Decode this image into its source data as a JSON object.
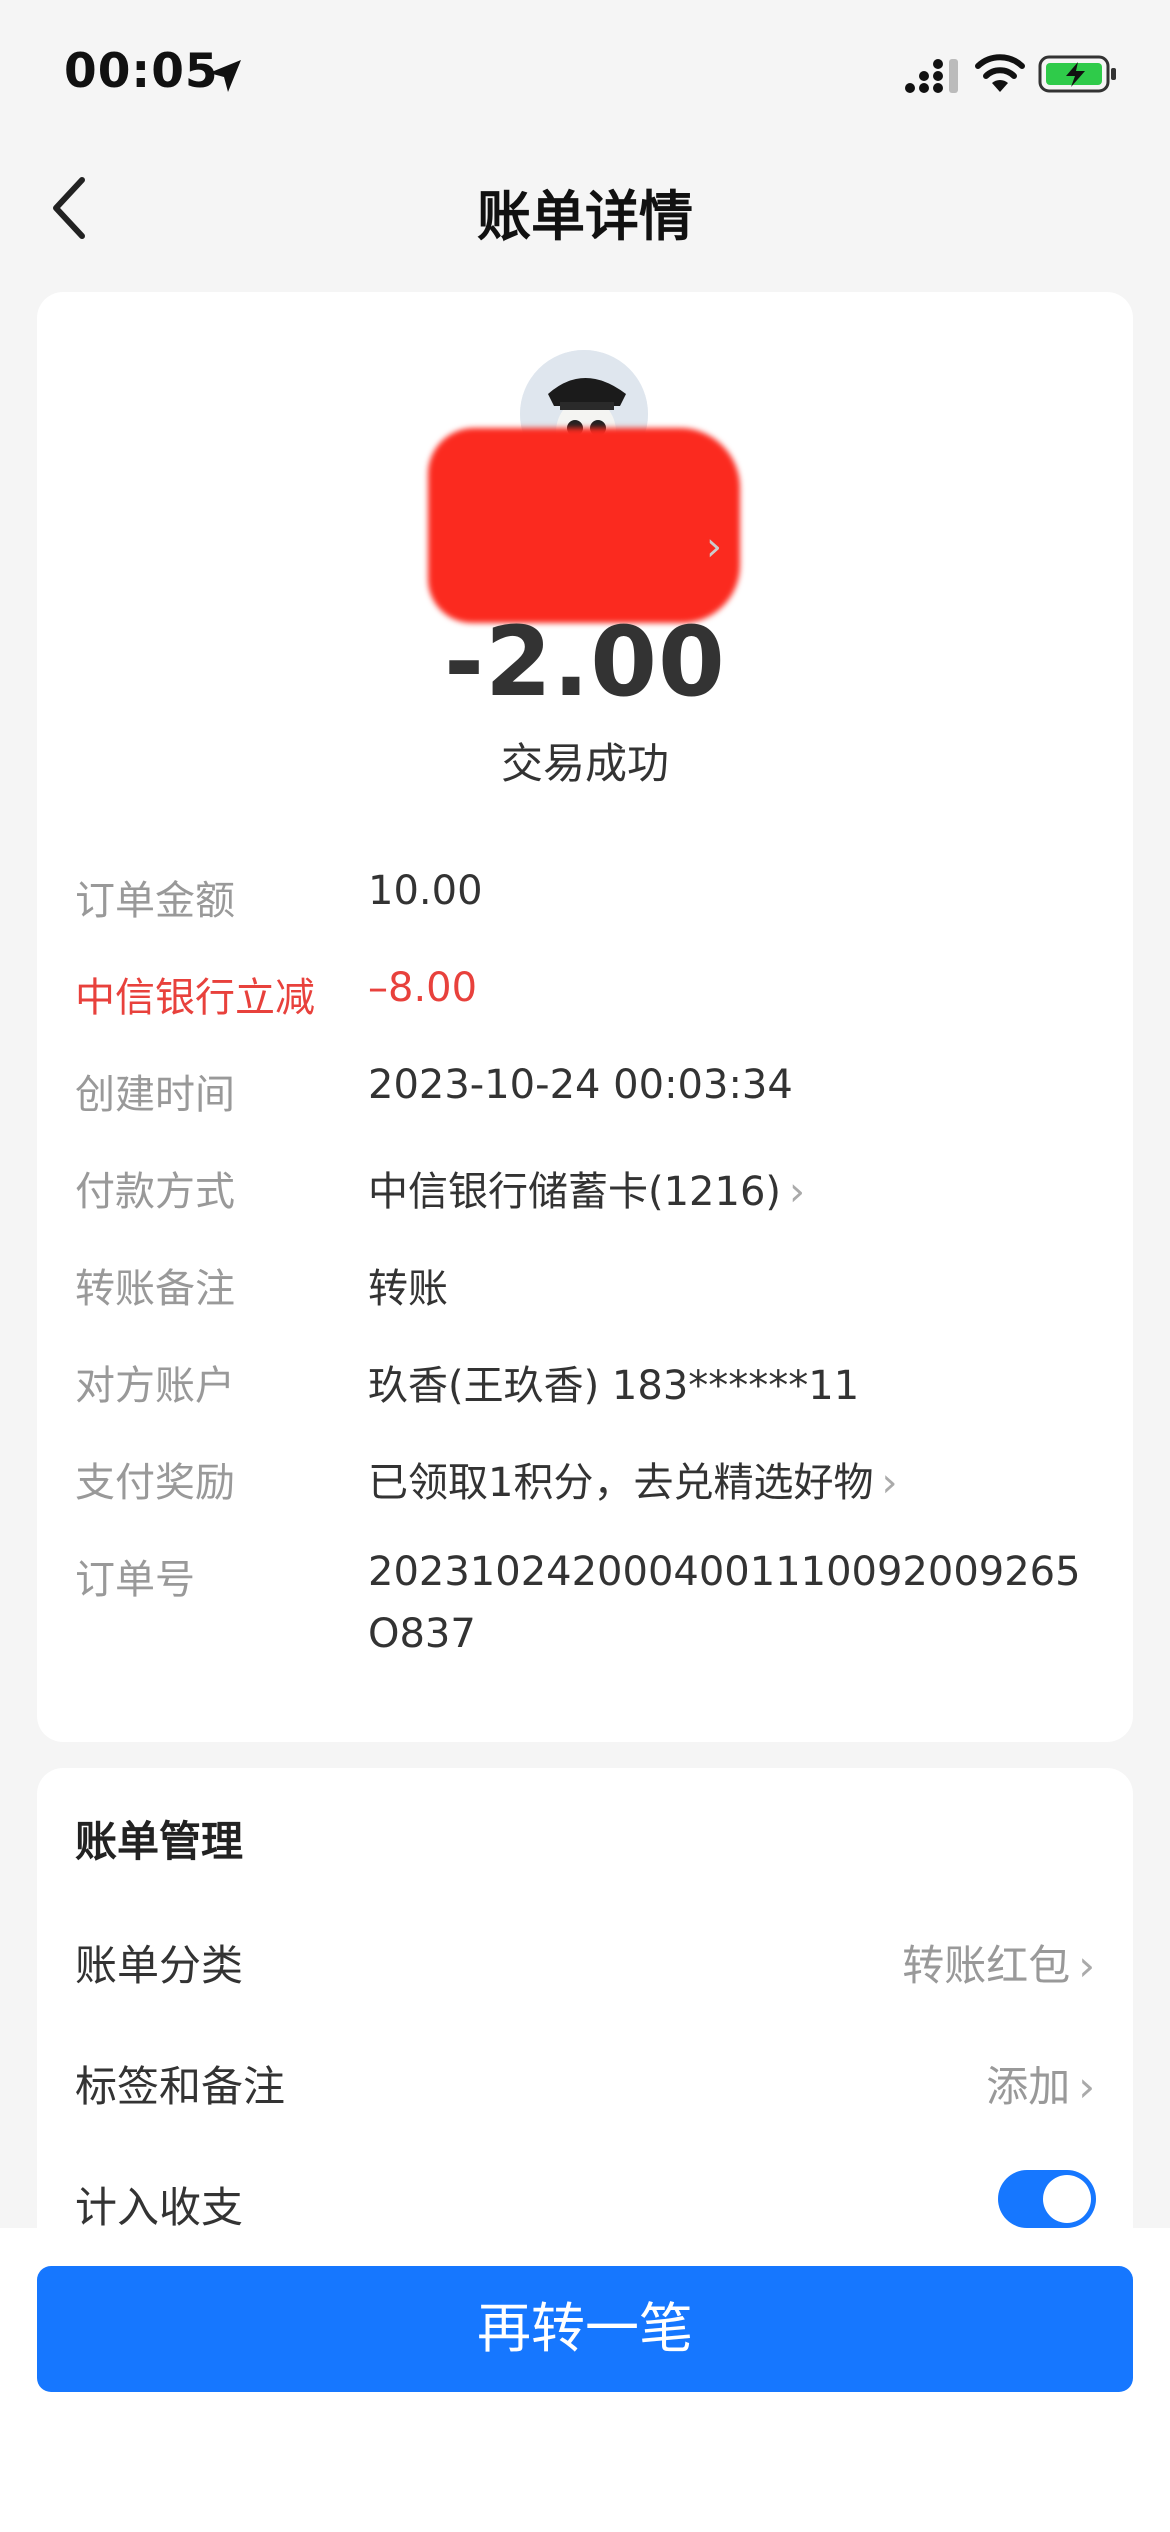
{
  "status_bar": {
    "time": "00:05"
  },
  "nav": {
    "title": "账单详情"
  },
  "transaction": {
    "amount": "-2.00",
    "status": "交易成功",
    "details": [
      {
        "label": "订单金额",
        "value": "10.00"
      },
      {
        "label": "中信银行立减",
        "value": "–8.00",
        "highlight": true
      },
      {
        "label": "创建时间",
        "value": "2023-10-24 00:03:34"
      },
      {
        "label": "付款方式",
        "value": "中信银行储蓄卡(1216)",
        "chevron": true
      },
      {
        "label": "转账备注",
        "value": "转账"
      },
      {
        "label": "对方账户",
        "value": "玖香(王玖香) 183******11"
      },
      {
        "label": "支付奖励",
        "value": "已领取1积分，去兑精选好物",
        "chevron": true
      },
      {
        "label": "订单号",
        "value": "2023102420004001110092009265O837"
      }
    ]
  },
  "management": {
    "title": "账单管理",
    "items": [
      {
        "label": "账单分类",
        "value": "转账红包"
      },
      {
        "label": "标签和备注",
        "value": "添加"
      },
      {
        "label": "计入收支",
        "toggle_on": true
      }
    ]
  },
  "actions": {
    "transfer_again": "再转一笔"
  },
  "colors": {
    "accent": "#1677ff",
    "discount_red": "#e8413c",
    "redaction": "#fb2a1f"
  },
  "icons": {
    "back": "chevron-left-icon",
    "chevron": "chevron-right-icon"
  }
}
